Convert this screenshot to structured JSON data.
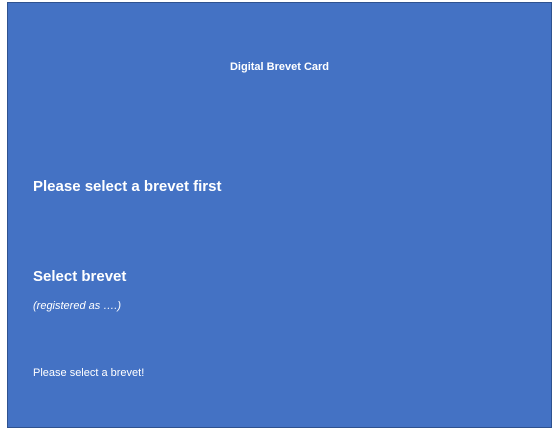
{
  "app": {
    "title": "Digital Brevet Card"
  },
  "main": {
    "prompt": "Please select a brevet first",
    "select_label": "Select brevet",
    "registered_as": "(registered as ….)",
    "message": "Please select a brevet!"
  },
  "colors": {
    "background": "#4472c4",
    "text": "#ffffff"
  }
}
